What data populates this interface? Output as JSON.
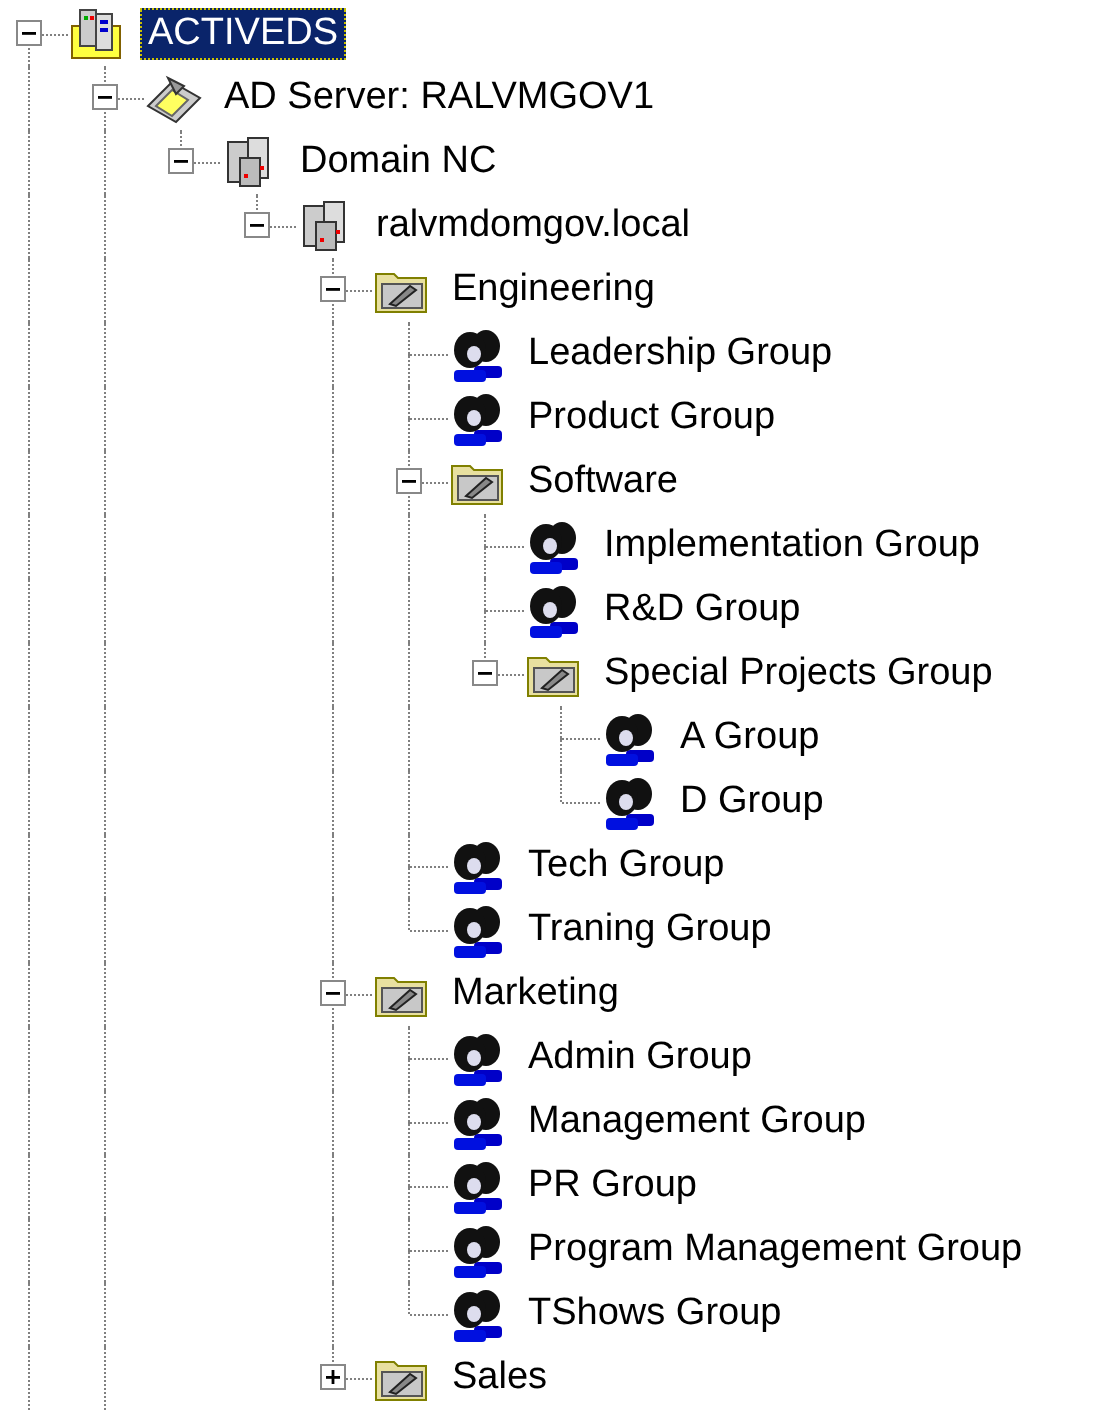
{
  "tree": [
    {
      "label": "ACTIVEDS",
      "kind": "root",
      "expanded": true,
      "selected": true,
      "children": [
        {
          "label": "AD Server: RALVMGOV1",
          "kind": "server",
          "expanded": true,
          "selected": false,
          "children": [
            {
              "label": "Domain NC",
              "kind": "domain",
              "expanded": true,
              "selected": false,
              "children": [
                {
                  "label": "ralvmdomgov.local",
                  "kind": "domain",
                  "expanded": true,
                  "selected": false,
                  "children": [
                    {
                      "label": "Engineering",
                      "kind": "ou",
                      "expanded": true,
                      "selected": false,
                      "children": [
                        {
                          "label": "Leadership Group",
                          "kind": "group",
                          "selected": false
                        },
                        {
                          "label": "Product Group",
                          "kind": "group",
                          "selected": false
                        },
                        {
                          "label": "Software",
                          "kind": "ou",
                          "expanded": true,
                          "selected": false,
                          "children": [
                            {
                              "label": "Implementation Group",
                              "kind": "group",
                              "selected": false
                            },
                            {
                              "label": "R&D Group",
                              "kind": "group",
                              "selected": false
                            },
                            {
                              "label": "Special Projects Group",
                              "kind": "ou",
                              "expanded": true,
                              "selected": false,
                              "children": [
                                {
                                  "label": "A Group",
                                  "kind": "group",
                                  "selected": false
                                },
                                {
                                  "label": "D Group",
                                  "kind": "group",
                                  "selected": false
                                }
                              ]
                            }
                          ]
                        },
                        {
                          "label": "Tech Group",
                          "kind": "group",
                          "selected": false
                        },
                        {
                          "label": "Traning Group",
                          "kind": "group",
                          "selected": false
                        }
                      ]
                    },
                    {
                      "label": "Marketing",
                      "kind": "ou",
                      "expanded": true,
                      "selected": false,
                      "children": [
                        {
                          "label": "Admin Group",
                          "kind": "group",
                          "selected": false
                        },
                        {
                          "label": "Management Group",
                          "kind": "group",
                          "selected": false
                        },
                        {
                          "label": "PR Group",
                          "kind": "group",
                          "selected": false
                        },
                        {
                          "label": "Program Management Group",
                          "kind": "group",
                          "selected": false
                        },
                        {
                          "label": "TShows Group",
                          "kind": "group",
                          "selected": false
                        }
                      ]
                    },
                    {
                      "label": "Sales",
                      "kind": "ou",
                      "expanded": false,
                      "selected": false
                    }
                  ]
                }
              ]
            }
          ]
        }
      ]
    }
  ]
}
